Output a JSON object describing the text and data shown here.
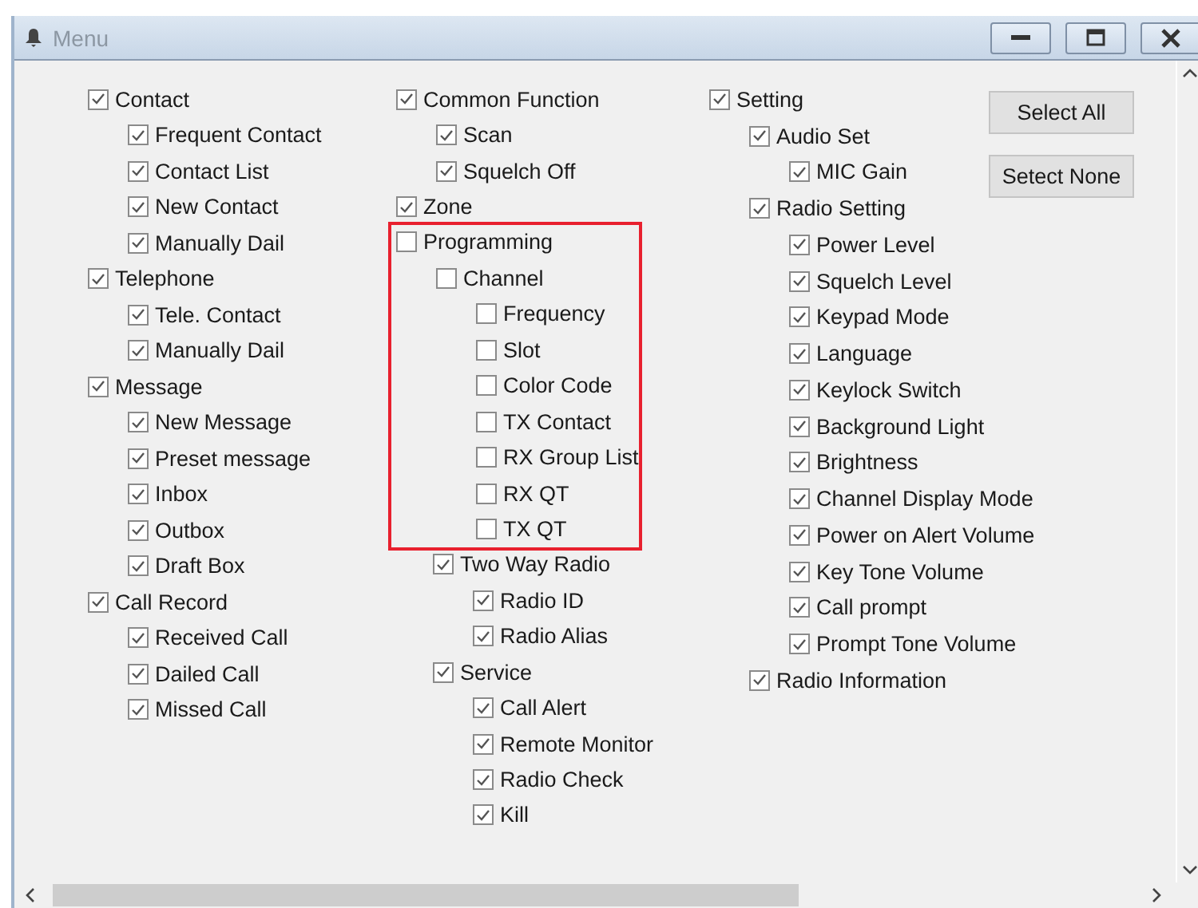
{
  "window": {
    "title": "Menu"
  },
  "columns": [
    {
      "items": [
        {
          "label": "Contact",
          "checked": true,
          "children": [
            {
              "label": "Frequent Contact",
              "checked": true
            },
            {
              "label": "Contact List",
              "checked": true
            },
            {
              "label": "New Contact",
              "checked": true
            },
            {
              "label": "Manually Dail",
              "checked": true
            }
          ]
        },
        {
          "label": "Telephone",
          "checked": true,
          "children": [
            {
              "label": "Tele. Contact",
              "checked": true
            },
            {
              "label": "Manually Dail",
              "checked": true
            }
          ]
        },
        {
          "label": "Message",
          "checked": true,
          "children": [
            {
              "label": "New Message",
              "checked": true
            },
            {
              "label": "Preset message",
              "checked": true
            },
            {
              "label": "Inbox",
              "checked": true
            },
            {
              "label": "Outbox",
              "checked": true
            },
            {
              "label": "Draft Box",
              "checked": true
            }
          ]
        },
        {
          "label": "Call Record",
          "checked": true,
          "children": [
            {
              "label": "Received Call",
              "checked": true
            },
            {
              "label": "Dailed Call",
              "checked": true
            },
            {
              "label": "Missed Call",
              "checked": true
            }
          ]
        }
      ]
    },
    {
      "items": [
        {
          "label": "Common Function",
          "checked": true,
          "children": [
            {
              "label": "Scan",
              "checked": true
            },
            {
              "label": "Squelch Off",
              "checked": true
            }
          ]
        },
        {
          "label": "Zone",
          "checked": true
        },
        {
          "label": "Programming",
          "checked": false,
          "highlighted": true,
          "children": [
            {
              "label": "Channel",
              "checked": false,
              "children": [
                {
                  "label": "Frequency",
                  "checked": false
                },
                {
                  "label": "Slot",
                  "checked": false
                },
                {
                  "label": "Color Code",
                  "checked": false
                },
                {
                  "label": "TX Contact",
                  "checked": false
                },
                {
                  "label": "RX Group List",
                  "checked": false
                },
                {
                  "label": "RX QT",
                  "checked": false
                },
                {
                  "label": "TX QT",
                  "checked": false
                }
              ]
            }
          ]
        },
        {
          "label": "Two Way Radio",
          "checked": true,
          "indented": true,
          "children": [
            {
              "label": "Radio ID",
              "checked": true
            },
            {
              "label": "Radio Alias",
              "checked": true
            }
          ]
        },
        {
          "label": "Service",
          "checked": true,
          "indented": true,
          "children": [
            {
              "label": "Call Alert",
              "checked": true
            },
            {
              "label": "Remote Monitor",
              "checked": true
            },
            {
              "label": "Radio Check",
              "checked": true
            },
            {
              "label": "Kill",
              "checked": true
            }
          ]
        }
      ]
    },
    {
      "items": [
        {
          "label": "Setting",
          "checked": true,
          "children": [
            {
              "label": "Audio Set",
              "checked": true,
              "children": [
                {
                  "label": "MIC Gain",
                  "checked": true
                }
              ]
            },
            {
              "label": "Radio Setting",
              "checked": true,
              "children": [
                {
                  "label": "Power Level",
                  "checked": true
                },
                {
                  "label": "Squelch Level",
                  "checked": true
                },
                {
                  "label": "Keypad Mode",
                  "checked": true
                },
                {
                  "label": "Language",
                  "checked": true
                },
                {
                  "label": "Keylock Switch",
                  "checked": true
                },
                {
                  "label": "Background Light",
                  "checked": true
                },
                {
                  "label": "Brightness",
                  "checked": true
                },
                {
                  "label": "Channel Display Mode",
                  "checked": true
                },
                {
                  "label": "Power on Alert Volume",
                  "checked": true
                },
                {
                  "label": "Key Tone Volume",
                  "checked": true
                },
                {
                  "label": "Call prompt",
                  "checked": true
                },
                {
                  "label": "Prompt Tone Volume",
                  "checked": true
                }
              ]
            },
            {
              "label": "Radio Information",
              "checked": true
            }
          ]
        }
      ]
    }
  ],
  "buttons": [
    "Select All",
    "Setect None"
  ]
}
